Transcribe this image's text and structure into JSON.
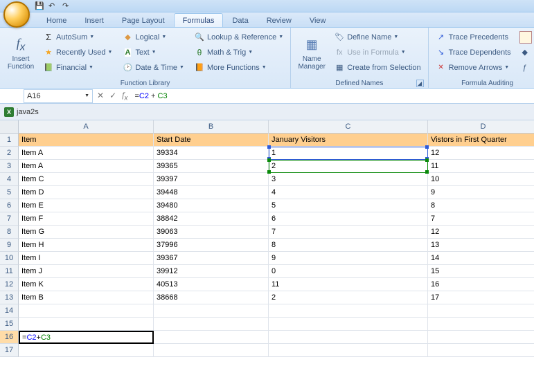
{
  "tabs": {
    "home": "Home",
    "insert": "Insert",
    "pagelayout": "Page Layout",
    "formulas": "Formulas",
    "data": "Data",
    "review": "Review",
    "view": "View"
  },
  "ribbon": {
    "insertFn1": "Insert",
    "insertFn2": "Function",
    "autosum": "AutoSum",
    "recent": "Recently Used",
    "financial": "Financial",
    "logical": "Logical",
    "text": "Text",
    "datetime": "Date & Time",
    "lookup": "Lookup & Reference",
    "math": "Math & Trig",
    "more": "More Functions",
    "groupLib": "Function Library",
    "name1": "Name",
    "name2": "Manager",
    "defName": "Define Name",
    "useForm": "Use in Formula",
    "createSel": "Create from Selection",
    "groupNames": "Defined Names",
    "tracePrec": "Trace Precedents",
    "traceDep": "Trace Dependents",
    "removeArr": "Remove Arrows",
    "groupAudit": "Formula Auditing"
  },
  "nameBox": "A16",
  "formula": "=C2 + C3",
  "formulaParts": {
    "eq": "=",
    "p1": "C2",
    "mid": " + ",
    "p2": "C3"
  },
  "workbook": "java2s",
  "cols": [
    "A",
    "B",
    "C",
    "D"
  ],
  "headers": {
    "a": "Item",
    "b": "Start Date",
    "c": "January Visitors",
    "d": "Vistors in First Quarter"
  },
  "rows": [
    {
      "n": "2",
      "a": "Item A",
      "b": "39334",
      "c": "1",
      "d": "12"
    },
    {
      "n": "3",
      "a": "Item A",
      "b": "39365",
      "c": "2",
      "d": "11"
    },
    {
      "n": "4",
      "a": "Item C",
      "b": "39397",
      "c": "3",
      "d": "10"
    },
    {
      "n": "5",
      "a": "Item D",
      "b": "39448",
      "c": "4",
      "d": "9"
    },
    {
      "n": "6",
      "a": "Item E",
      "b": "39480",
      "c": "5",
      "d": "8"
    },
    {
      "n": "7",
      "a": "Item F",
      "b": "38842",
      "c": "6",
      "d": "7"
    },
    {
      "n": "8",
      "a": "Item G",
      "b": "39063",
      "c": "7",
      "d": "12"
    },
    {
      "n": "9",
      "a": "Item H",
      "b": "37996",
      "c": "8",
      "d": "13"
    },
    {
      "n": "10",
      "a": "Item I",
      "b": "39367",
      "c": "9",
      "d": "14"
    },
    {
      "n": "11",
      "a": "Item J",
      "b": "39912",
      "c": "0",
      "d": "15"
    },
    {
      "n": "12",
      "a": "Item K",
      "b": "40513",
      "c": "11",
      "d": "16"
    },
    {
      "n": "13",
      "a": "Item B",
      "b": "38668",
      "c": "2",
      "d": "17"
    }
  ]
}
